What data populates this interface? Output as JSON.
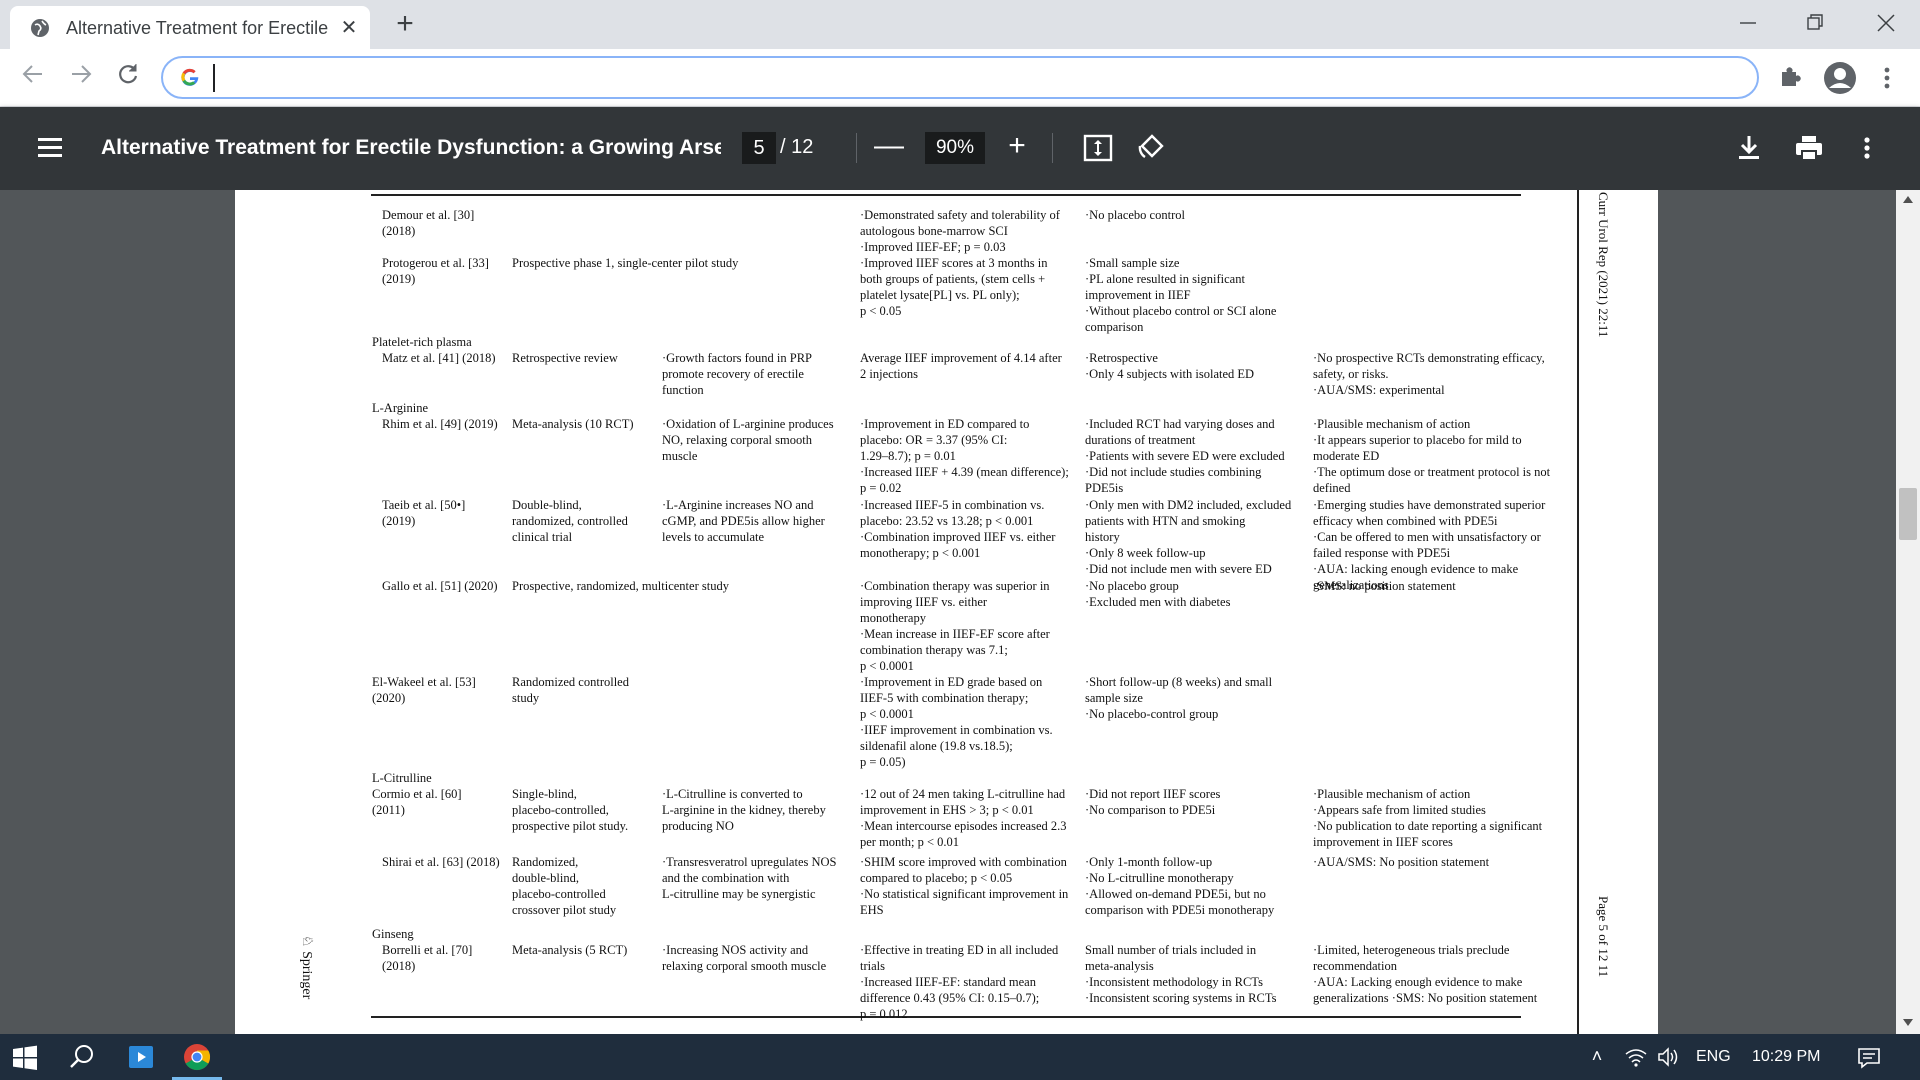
{
  "browser": {
    "tab_title": "Alternative Treatment for Erectile",
    "tab_close": "✕",
    "new_tab": "+",
    "omnibox_value": ""
  },
  "pdf_toolbar": {
    "title": "Alternative Treatment for Erectile Dysfunction: a Growing Arsen...",
    "page_current": "5",
    "page_total": "/ 12",
    "zoom": "90%",
    "zoom_out": "—",
    "zoom_in": "+"
  },
  "document": {
    "running_header": "Curr Urol Rep   (2021) 22:11",
    "page_footer": "Page 5 of 12   11",
    "publisher": "Springer",
    "sections": {
      "prp": "Platelet-rich plasma",
      "larginine": "L-Arginine",
      "lcitrulline": "L-Citrulline",
      "ginseng": "Ginseng"
    },
    "rows": [
      {
        "study": "Demour et al. [30]\n  (2018)",
        "design": "",
        "mechanism": "",
        "results": "·Demonstrated safety and tolerability of\n  autologous bone-marrow SCI\n·Improved IIEF-EF; p = 0.03",
        "limitations": "·No placebo control",
        "recs": ""
      },
      {
        "study": "Protogerou et al. [33]\n  (2019)",
        "design": "Prospective phase 1, single-center pilot study",
        "mechanism": "",
        "results": "·Improved IIEF scores at 3 months in\n  both groups of patients, (stem cells +\n  platelet lysate[PL] vs. PL only);\n  p < 0.05",
        "limitations": "·Small sample size\n·PL alone resulted in significant\n  improvement in IIEF\n·Without placebo control or SCI alone\n  comparison",
        "recs": ""
      },
      {
        "study": "Matz et al. [41] (2018)",
        "design": "Retrospective review",
        "mechanism": "·Growth factors found in PRP\n  promote recovery of erectile\n  function",
        "results": "Average IIEF improvement of 4.14 after\n  2 injections",
        "limitations": "·Retrospective\n·Only 4 subjects with isolated ED",
        "recs": "·No prospective RCTs demonstrating efficacy,\n  safety, or risks.\n·AUA/SMS: experimental"
      },
      {
        "study": "Rhim et al. [49] (2019)",
        "design": "Meta-analysis (10 RCT)",
        "mechanism": "·Oxidation of L-arginine produces\n  NO, relaxing corporal smooth\n  muscle",
        "results": "·Improvement in ED compared to\n  placebo: OR = 3.37 (95% CI:\n  1.29–8.7); p = 0.01\n·Increased IIEF + 4.39 (mean difference);\n  p = 0.02",
        "limitations": "·Included RCT had varying doses and\n  durations of treatment\n·Patients with severe ED were excluded\n·Did not include studies combining\n  PDE5is",
        "recs": "·Plausible mechanism of action\n·It appears superior to placebo for mild to\n  moderate ED\n·The optimum dose or treatment protocol is not\n  defined"
      },
      {
        "study": "Taeib et al. [50•]\n  (2019)",
        "design": "Double-blind,\n  randomized, controlled\n  clinical trial",
        "mechanism": "·L-Arginine increases NO and\n  cGMP, and PDE5is allow higher\n  levels to accumulate",
        "results": "·Increased IIEF-5 in combination vs.\n  placebo: 23.52 vs 13.28; p < 0.001\n·Combination improved IIEF vs. either\n  monotherapy; p < 0.001",
        "limitations": "·Only men with DM2 included, excluded\n  patients with HTN and smoking\n  history\n·Only 8 week follow-up\n·Did not include men with severe ED",
        "recs": "·Emerging studies have demonstrated superior\n  efficacy when combined with PDE5i\n·Can be offered to men with unsatisfactory or\n  failed response with PDE5i\n·AUA: lacking enough evidence to make\n  generalizations"
      },
      {
        "study": "Gallo et al. [51] (2020)",
        "design": "Prospective, randomized, multicenter study",
        "mechanism": "",
        "results": "·Combination therapy was superior in\n  improving IIEF vs. either\n  monotherapy\n·Mean increase in IIEF-EF score after\n  combination therapy was 7.1;\n  p < 0.0001",
        "limitations": "·No placebo group\n·Excluded men with diabetes",
        "recs": "·SMS: no position statement"
      },
      {
        "study": "El-Wakeel et al. [53]\n(2020)",
        "design": "Randomized controlled\nstudy",
        "mechanism": "",
        "results": "·Improvement in ED grade based on\n  IIEF-5 with combination therapy;\n  p < 0.0001\n·IIEF improvement in combination vs.\n  sildenafil alone (19.8 vs.18.5);\n  p = 0.05)",
        "limitations": "·Short follow-up (8 weeks) and small\nsample size\n·No placebo-control group",
        "recs": ""
      },
      {
        "study": "Cormio et al. [60]\n(2011)",
        "design": "Single-blind,\n  placebo-controlled,\n  prospective pilot study.",
        "mechanism": "·L-Citrulline is converted to\n  L-arginine in the kidney, thereby\n  producing NO",
        "results": "·12 out of 24 men taking L-citrulline had\n  improvement in EHS > 3; p < 0.01\n·Mean intercourse episodes increased 2.3\n  per month; p < 0.01",
        "limitations": "·Did not report IIEF scores\n·No comparison to PDE5i",
        "recs": "·Plausible mechanism of action\n·Appears safe from limited studies\n·No publication to date reporting a significant\n  improvement in IIEF scores"
      },
      {
        "study": "Shirai et al. [63] (2018)",
        "design": "Randomized,\n  double-blind,\n  placebo-controlled\n  crossover pilot study",
        "mechanism": "·Transresveratrol upregulates NOS\n  and the combination with\n  L-citrulline may be synergistic",
        "results": "·SHIM score improved with combination\n  compared to placebo; p < 0.05\n·No statistical significant improvement in\n  EHS",
        "limitations": "·Only 1-month follow-up\n·No L-citrulline monotherapy\n·Allowed on-demand PDE5i, but no\n  comparison with PDE5i monotherapy",
        "recs": "·AUA/SMS: No position statement"
      },
      {
        "study": "Borrelli et al. [70]\n  (2018)",
        "design": "Meta-analysis (5 RCT)",
        "mechanism": "·Increasing NOS activity and\n  relaxing corporal smooth muscle",
        "results": "·Effective in treating ED in all included\n  trials\n·Increased IIEF-EF: standard mean\n  difference 0.43 (95% CI: 0.15–0.7);\n  p = 0.012",
        "limitations": "Small number of trials included in\n  meta-analysis\n·Inconsistent methodology in RCTs\n·Inconsistent scoring systems in RCTs",
        "recs": "·Limited, heterogeneous trials preclude\n  recommendation\n·AUA: Lacking enough evidence to make\n  generalizations ·SMS: No position statement"
      }
    ]
  },
  "taskbar": {
    "language": "ENG",
    "time": "10:29 PM"
  }
}
